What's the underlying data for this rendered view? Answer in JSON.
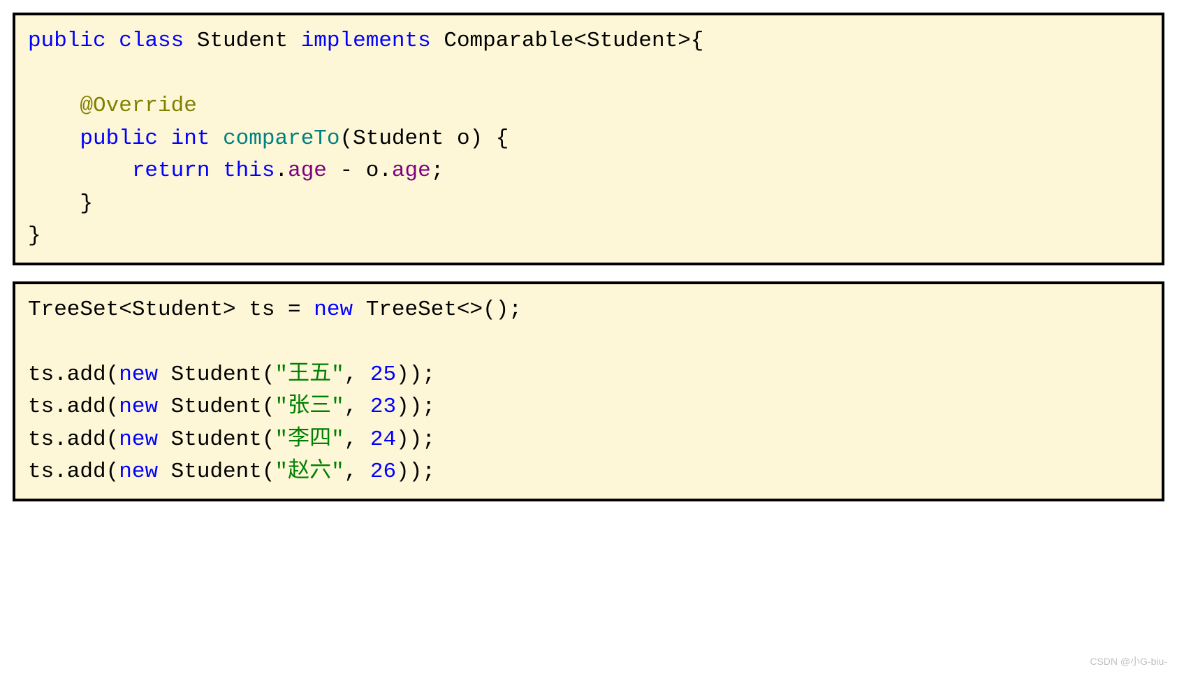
{
  "block1": {
    "l1": {
      "public": "public",
      "class": "class",
      "student": "Student",
      "implements": "implements",
      "comparable": "Comparable<Student>{"
    },
    "l2": "",
    "l3": {
      "override": "@Override"
    },
    "l4": {
      "public": "public",
      "int": "int",
      "compareTo": "compareTo",
      "params": "(Student o) {"
    },
    "l5": {
      "return": "return",
      "this": "this",
      "dot1": ".",
      "age1": "age",
      "minus": " - o.",
      "age2": "age",
      "semi": ";"
    },
    "l6": "    }",
    "l7": "}"
  },
  "block2": {
    "l1": {
      "pre": "TreeSet<Student> ts = ",
      "new": "new",
      "post": " TreeSet<>();"
    },
    "l2": "",
    "l3": {
      "pre": "ts.add(",
      "new": "new",
      "mid": " Student(",
      "str": "\"王五\"",
      "comma": ", ",
      "num": "25",
      "post": "));"
    },
    "l4": {
      "pre": "ts.add(",
      "new": "new",
      "mid": " Student(",
      "str": "\"张三\"",
      "comma": ", ",
      "num": "23",
      "post": "));"
    },
    "l5": {
      "pre": "ts.add(",
      "new": "new",
      "mid": " Student(",
      "str": "\"李四\"",
      "comma": ", ",
      "num": "24",
      "post": "));"
    },
    "l6": {
      "pre": "ts.add(",
      "new": "new",
      "mid": " Student(",
      "str": "\"赵六\"",
      "comma": ", ",
      "num": "26",
      "post": "));"
    }
  },
  "watermark": "CSDN @小G-biu-"
}
